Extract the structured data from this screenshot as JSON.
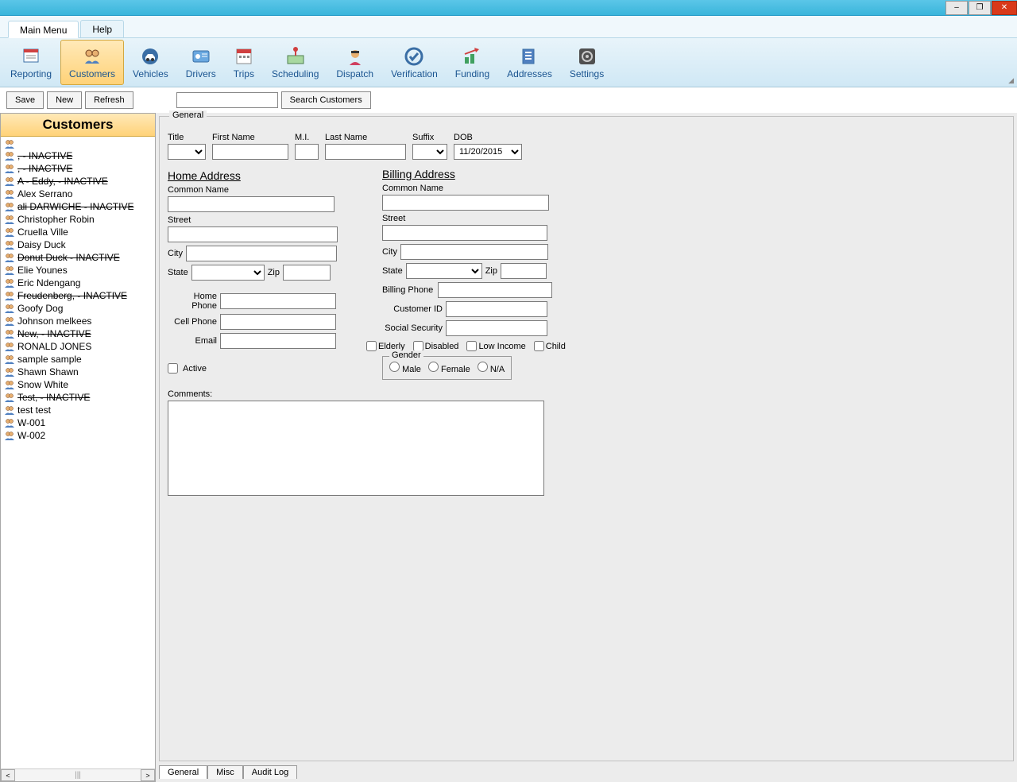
{
  "window": {
    "minimize": "–",
    "maximize": "❐",
    "close": "✕"
  },
  "menus": {
    "main": "Main Menu",
    "help": "Help"
  },
  "ribbon": [
    {
      "id": "reporting",
      "label": "Reporting"
    },
    {
      "id": "customers",
      "label": "Customers",
      "active": true
    },
    {
      "id": "vehicles",
      "label": "Vehicles"
    },
    {
      "id": "drivers",
      "label": "Drivers"
    },
    {
      "id": "trips",
      "label": "Trips"
    },
    {
      "id": "scheduling",
      "label": "Scheduling"
    },
    {
      "id": "dispatch",
      "label": "Dispatch"
    },
    {
      "id": "verification",
      "label": "Verification"
    },
    {
      "id": "funding",
      "label": "Funding"
    },
    {
      "id": "addresses",
      "label": "Addresses"
    },
    {
      "id": "settings",
      "label": "Settings"
    }
  ],
  "actions": {
    "save": "Save",
    "new": "New",
    "refresh": "Refresh",
    "search_btn": "Search Customers",
    "search_value": ""
  },
  "sidebar": {
    "title": "Customers",
    "items": [
      {
        "label": ""
      },
      {
        "label": ", - INACTIVE",
        "inactive": true
      },
      {
        "label": ", - INACTIVE",
        "inactive": true
      },
      {
        "label": "A - Eddy, - INACTIVE",
        "inactive": true
      },
      {
        "label": "Alex Serrano"
      },
      {
        "label": "ali DARWICHE - INACTIVE",
        "inactive": true
      },
      {
        "label": "Christopher Robin"
      },
      {
        "label": "Cruella Ville"
      },
      {
        "label": "Daisy Duck"
      },
      {
        "label": "Donut Duck - INACTIVE",
        "inactive": true
      },
      {
        "label": "Elie  Younes"
      },
      {
        "label": "Eric Ndengang"
      },
      {
        "label": "Freudenberg, - INACTIVE",
        "inactive": true
      },
      {
        "label": "Goofy Dog"
      },
      {
        "label": "Johnson melkees"
      },
      {
        "label": "New, - INACTIVE",
        "inactive": true
      },
      {
        "label": "RONALD JONES"
      },
      {
        "label": "sample sample"
      },
      {
        "label": "Shawn Shawn"
      },
      {
        "label": "Snow White"
      },
      {
        "label": "Test, - INACTIVE",
        "inactive": true
      },
      {
        "label": "test test"
      },
      {
        "label": "W-001"
      },
      {
        "label": "W-002"
      }
    ]
  },
  "form": {
    "legend": "General",
    "identity": {
      "title_lbl": "Title",
      "title": "",
      "first_lbl": "First Name",
      "first": "",
      "mi_lbl": "M.I.",
      "mi": "",
      "last_lbl": "Last Name",
      "last": "",
      "suffix_lbl": "Suffix",
      "suffix": "",
      "dob_lbl": "DOB",
      "dob": "11/20/2015"
    },
    "home": {
      "heading": "Home Address",
      "common_lbl": "Common Name",
      "common": "",
      "street_lbl": "Street",
      "street": "",
      "city_lbl": "City",
      "city": "",
      "state_lbl": "State",
      "state": "",
      "zip_lbl": "Zip",
      "zip": "",
      "homephone_lbl": "Home Phone",
      "homephone": "",
      "cellphone_lbl": "Cell Phone",
      "cellphone": "",
      "email_lbl": "Email",
      "email": "",
      "active_lbl": "Active"
    },
    "billing": {
      "heading": "Billing Address",
      "common_lbl": "Common Name",
      "common": "",
      "street_lbl": "Street",
      "street": "",
      "city_lbl": "City",
      "city": "",
      "state_lbl": "State",
      "state": "",
      "zip_lbl": "Zip",
      "zip": "",
      "phone_lbl": "Billing Phone",
      "phone": "",
      "custid_lbl": "Customer ID",
      "custid": "",
      "ssn_lbl": "Social Security",
      "ssn": ""
    },
    "flags": {
      "elderly": "Elderly",
      "disabled": "Disabled",
      "lowincome": "Low Income",
      "child": "Child"
    },
    "gender": {
      "legend": "Gender",
      "male": "Male",
      "female": "Female",
      "na": "N/A"
    },
    "comments_lbl": "Comments:",
    "comments": ""
  },
  "bottomtabs": {
    "general": "General",
    "misc": "Misc",
    "audit": "Audit Log"
  }
}
